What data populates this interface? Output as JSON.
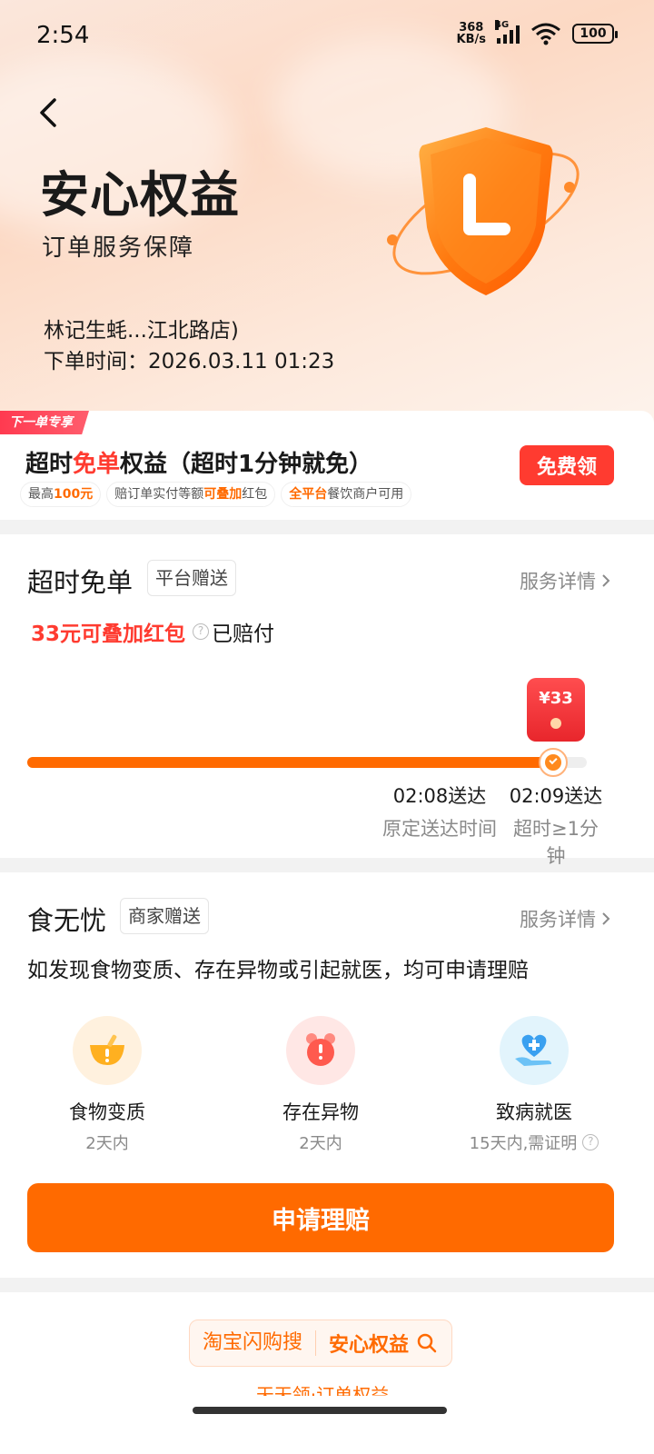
{
  "status": {
    "time": "2:54",
    "net_speed_top": "368",
    "net_speed_bottom": "KB/s",
    "network": "4G",
    "battery": "100"
  },
  "hero": {
    "title": "安心权益",
    "subtitle": "订单服务保障",
    "shop": "林记生蚝...江北路店)",
    "order_time": "下单时间：2026.03.11 01:23"
  },
  "promo": {
    "tag": "下一单专享",
    "title_pre": "超时",
    "title_red": "免单",
    "title_post": "权益（超时1分钟就免）",
    "chip1_pre": "最高",
    "chip1_hl": "100元",
    "chip2_pre": "赔订单实付等额",
    "chip2_hl": "可叠加",
    "chip2_post": "红包",
    "chip3_hl": "全平台",
    "chip3_post": "餐饮商户可用",
    "button": "免费领"
  },
  "overtime": {
    "title": "超时免单",
    "tag": "平台赠送",
    "detail_link": "服务详情",
    "comp_amount": "33元可叠加红包",
    "comp_status": "已赔付",
    "redpack": "¥33",
    "progress": 0.94,
    "planned_time": "02:08送达",
    "planned_label": "原定送达时间",
    "actual_time": "02:09送达",
    "actual_label": "超时≥1分钟"
  },
  "food": {
    "title": "食无忧",
    "tag": "商家赠送",
    "detail_link": "服务详情",
    "desc": "如发现食物变质、存在异物或引起就医，均可申请理赔",
    "items": [
      {
        "name": "食物变质",
        "sub": "2天内",
        "icon": "spoiled-food-icon"
      },
      {
        "name": "存在异物",
        "sub": "2天内",
        "icon": "foreign-object-icon"
      },
      {
        "name": "致病就医",
        "sub": "15天内,需证明",
        "icon": "medical-icon"
      }
    ],
    "apply_button": "申请理赔"
  },
  "bottom": {
    "search_left": "淘宝闪购搜",
    "search_right": "安心权益",
    "peek": "天天领·订单权益"
  },
  "colors": {
    "accent": "#ff6a00",
    "red": "#ff3b30"
  }
}
